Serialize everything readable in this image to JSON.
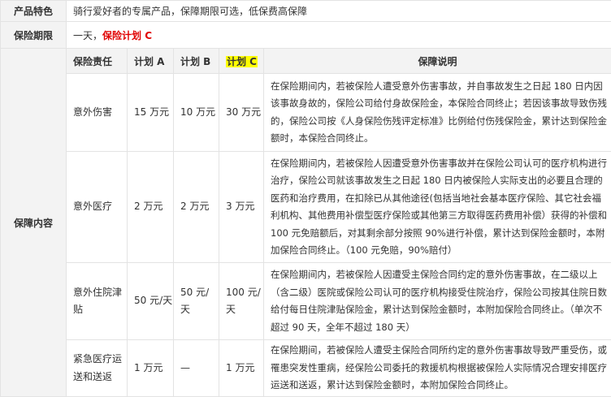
{
  "features": {
    "label": "产品特色",
    "text": "骑行爱好者的专属产品，保障期限可选，低保费高保障"
  },
  "period": {
    "label": "保险期限",
    "prefix": "一天，",
    "plan": "保险计划 C"
  },
  "coverage": {
    "label": "保障内容",
    "headers": {
      "item": "保险责任",
      "a": "计划 A",
      "b": "计划 B",
      "c": "计划 C",
      "desc": "保障说明"
    },
    "rows": [
      {
        "name": "意外伤害",
        "a": "15 万元",
        "b": "10 万元",
        "c": "30 万元",
        "desc": "在保险期间内，若被保险人遭受意外伤害事故，并自事故发生之日起 180 日内因该事故身故的，保险公司给付身故保险金，本保险合同终止；若因该事故导致伤残的，保险公司按《人身保险伤残评定标准》比例给付伤残保险金，累计达到保险金额时，本保险合同终止。"
      },
      {
        "name": "意外医疗",
        "a": "2 万元",
        "b": "2 万元",
        "c": "3 万元",
        "desc": "在保险期间内，若被保险人因遭受意外伤害事故并在保险公司认可的医疗机构进行治疗，保险公司就该事故发生之日起 180 日内被保险人实际支出的必要且合理的医药和治疗费用，在扣除已从其他途径(包括当地社会基本医疗保险、其它社会福利机构、其他费用补偿型医疗保险或其他第三方取得医药费用补偿）获得的补偿和 100 元免赔额后，对其剩余部分按照 90%进行补偿，累计达到保险金额时，本附加保险合同终止。（100 元免赔，90%赔付）"
      },
      {
        "name": "意外住院津贴",
        "a": "50 元/天",
        "b": "50 元/天",
        "c": "100 元/天",
        "desc": "在保险期间内，若被保险人因遭受主保险合同约定的意外伤害事故，在二级以上（含二级）医院或保险公司认可的医疗机构接受住院治疗，保险公司按其住院日数给付每日住院津贴保险金，累计达到保险金额时，本附加保险合同终止。（单次不超过 90 天，全年不超过 180 天）"
      },
      {
        "name": "紧急医疗运送和送返",
        "a": "1 万元",
        "b": "—",
        "c": "1 万元",
        "desc": "在保险期间，若被保险人遭受主保险合同所约定的意外伤害事故导致严重受伤，或罹患突发性重病，经保险公司委托的救援机构根据被保险人实际情况合理安排医疗运送和送返，累计达到保险金额时，本附加保险合同终止。"
      }
    ]
  }
}
